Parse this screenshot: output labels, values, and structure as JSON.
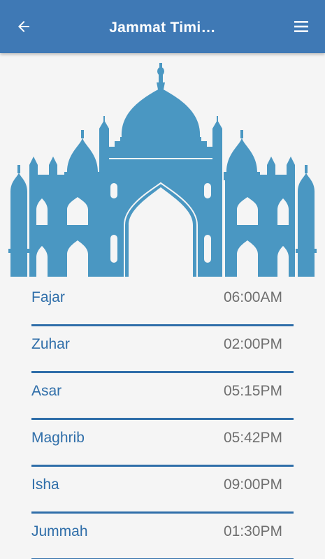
{
  "header": {
    "title": "Jammat Timi…",
    "back_icon": "arrow-left-icon",
    "menu_icon": "hamburger-menu-icon",
    "background_color": "#3f79b5"
  },
  "illustration": {
    "icon": "mosque-icon",
    "color": "#4a97c2"
  },
  "prayer_times": [
    {
      "name": "Fajar",
      "time": "06:00AM"
    },
    {
      "name": "Zuhar",
      "time": "02:00PM"
    },
    {
      "name": "Asar",
      "time": "05:15PM"
    },
    {
      "name": "Maghrib",
      "time": "05:42PM"
    },
    {
      "name": "Isha",
      "time": "09:00PM"
    },
    {
      "name": "Jummah",
      "time": "01:30PM"
    }
  ],
  "colors": {
    "accent": "#2f6ea9",
    "time_text": "#6f6f6f",
    "page_background": "#f5f5f5"
  }
}
